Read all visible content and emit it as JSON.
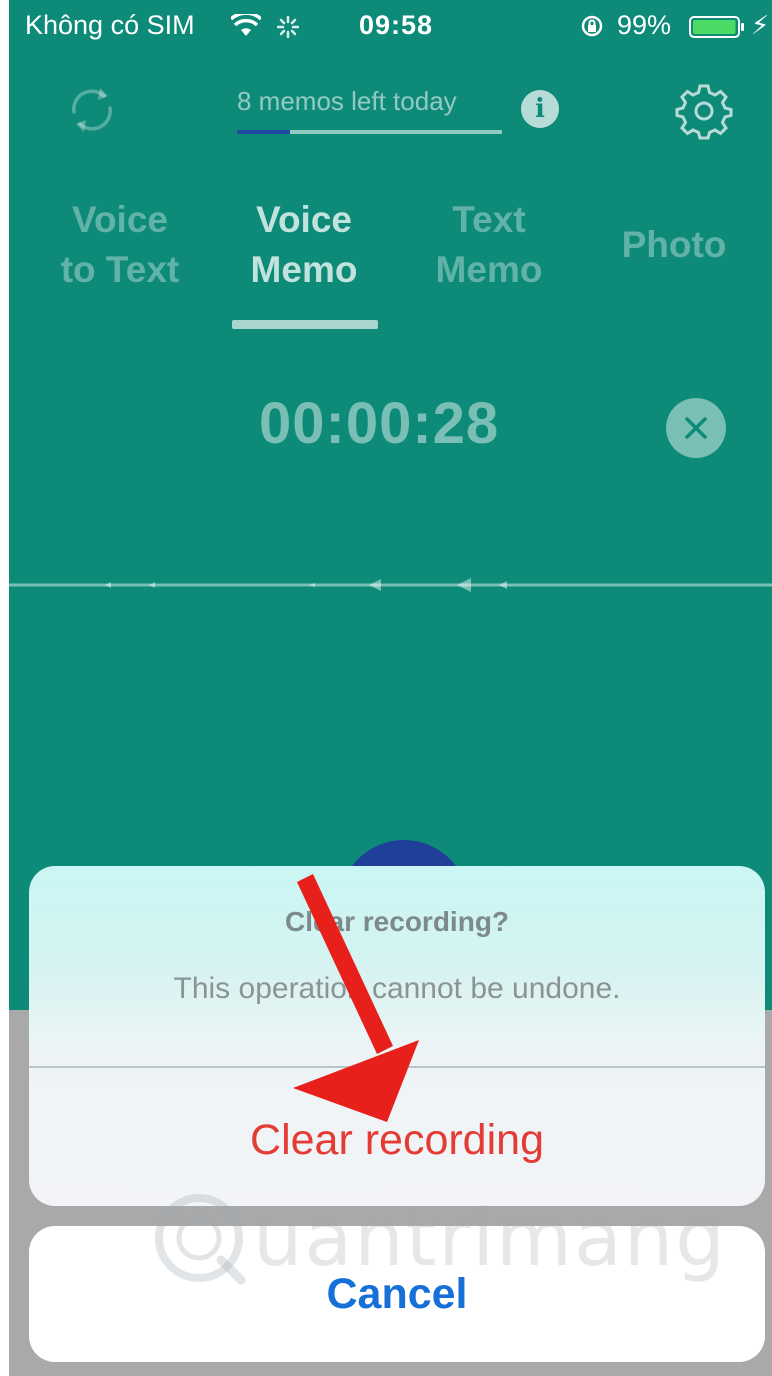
{
  "status_bar": {
    "carrier": "Không có SIM",
    "time": "09:58",
    "battery_percent": "99%",
    "battery_level": 0.99,
    "icons": [
      "wifi-icon",
      "spinner-icon",
      "orientation-lock-icon",
      "battery-icon",
      "charging-bolt-icon"
    ]
  },
  "top_bar": {
    "memos_left": "8 memos left today",
    "memos_progress": 0.2,
    "icons": [
      "sync-icon",
      "info-icon",
      "gear-icon"
    ],
    "info_glyph": "i"
  },
  "tabs": [
    {
      "label": "Voice\nto Text",
      "active": false
    },
    {
      "label": "Voice\nMemo",
      "active": true
    },
    {
      "label": "Text\nMemo",
      "active": false
    },
    {
      "label": "Photo",
      "active": false
    }
  ],
  "timer": "00:00:28",
  "alert": {
    "title": "Clear recording?",
    "message": "This operation cannot be undone.",
    "destructive_action": "Clear recording",
    "cancel": "Cancel"
  },
  "watermark": "uantrimang",
  "colors": {
    "background": "#0e8a78",
    "accent_progress": "#1f4aa0",
    "destructive": "#e53b35",
    "cancel": "#1670d8",
    "annotation_arrow": "#e8201c"
  }
}
